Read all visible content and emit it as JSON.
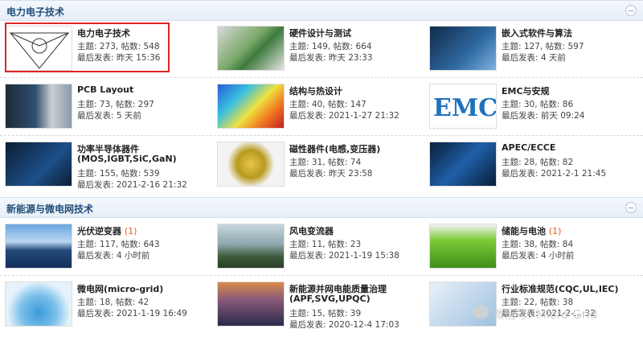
{
  "sections": [
    {
      "title": "电力电子技术",
      "forums": [
        {
          "name": "电力电子技术",
          "new": "",
          "topics_line": "主题: 273, 帖数: 548",
          "last_line": "最后发表: 昨天 15:36",
          "thumb_icon": "power-electronics-diagram-thumb"
        },
        {
          "name": "硬件设计与测试",
          "new": "",
          "topics_line": "主题: 149, 帖数: 664",
          "last_line": "最后发表: 昨天 23:33",
          "thumb_icon": "circuit-board-thumb"
        },
        {
          "name": "嵌入式软件与算法",
          "new": "",
          "topics_line": "主题: 127, 帖数: 597",
          "last_line": "最后发表: 4 天前",
          "thumb_icon": "keyboard-code-thumb"
        },
        {
          "name": "PCB Layout",
          "new": "",
          "topics_line": "主题: 73, 帖数: 297",
          "last_line": "最后发表: 5 天前",
          "thumb_icon": "pcb-engineer-thumb"
        },
        {
          "name": "结构与热设计",
          "new": "",
          "topics_line": "主题: 40, 帖数: 147",
          "last_line": "最后发表: 2021-1-27 21:32",
          "thumb_icon": "thermal-simulation-thumb"
        },
        {
          "name": "EMC与安规",
          "new": "",
          "topics_line": "主题: 30, 帖数: 86",
          "last_line": "最后发表: 前天 09:24",
          "thumb_icon": "emc-logo-thumb"
        },
        {
          "name": "功率半导体器件",
          "name2": "(MOS,IGBT,SiC,GaN)",
          "new": "",
          "topics_line": "主题: 155, 帖数: 539",
          "last_line": "最后发表: 2021-2-16 21:32",
          "thumb_icon": "semiconductor-chip-thumb"
        },
        {
          "name": "磁性器件(电感,变压器)",
          "new": "",
          "topics_line": "主题: 31, 帖数: 74",
          "last_line": "最后发表: 昨天 23:58",
          "thumb_icon": "transformer-thumb"
        },
        {
          "name": "APEC/ECCE",
          "new": "",
          "topics_line": "主题: 28, 帖数: 82",
          "last_line": "最后发表: 2021-2-1 21:45",
          "thumb_icon": "power-electronics-banner-thumb"
        }
      ]
    },
    {
      "title": "新能源与微电网技术",
      "forums": [
        {
          "name": "光伏逆变器",
          "new": "(1)",
          "topics_line": "主题: 117, 帖数: 643",
          "last_line": "最后发表: 4 小时前",
          "thumb_icon": "solar-panel-thumb"
        },
        {
          "name": "风电变流器",
          "new": "",
          "topics_line": "主题: 11, 帖数: 23",
          "last_line": "最后发表: 2021-1-19 15:38",
          "thumb_icon": "wind-turbine-thumb"
        },
        {
          "name": "储能与电池",
          "new": "(1)",
          "topics_line": "主题: 38, 帖数: 84",
          "last_line": "最后发表: 4 小时前",
          "thumb_icon": "battery-thumb"
        },
        {
          "name": "微电网(micro-grid)",
          "new": "",
          "topics_line": "主题: 18, 帖数: 42",
          "last_line": "最后发表: 2021-1-19 16:49",
          "thumb_icon": "microgrid-globe-thumb"
        },
        {
          "name": "新能源并网电能质量治理",
          "name2": "(APF,SVG,UPQC)",
          "new": "",
          "topics_line": "主题: 15, 帖数: 39",
          "last_line": "最后发表: 2020-12-4 17:03",
          "thumb_icon": "power-grid-thumb"
        },
        {
          "name": "行业标准规范(CQC,UL,IEC)",
          "new": "",
          "topics_line": "主题: 22, 帖数: 38",
          "last_line": "最后发表: 2021-2-...:32",
          "thumb_icon": "standards-thumb"
        }
      ]
    }
  ],
  "watermark": "微信号: Micro Grid",
  "colors": {
    "highlight": "#e02424",
    "section_title": "#1f4d7a",
    "new_count": "#e35b1e"
  }
}
